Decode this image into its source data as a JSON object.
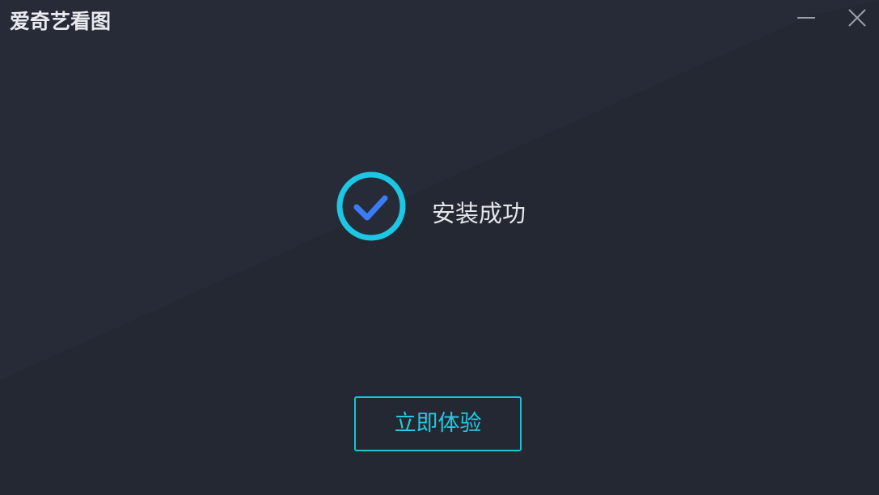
{
  "window": {
    "title": "爱奇艺看图"
  },
  "controls": {
    "minimize_icon": "minimize-icon",
    "close_icon": "close-icon"
  },
  "status": {
    "icon": "check-circle-icon",
    "message": "安装成功"
  },
  "actions": {
    "primary_label": "立即体验"
  },
  "colors": {
    "background": "#262b37",
    "accent_cyan": "#1fc2d6",
    "check_blue": "#3b7cf6",
    "text": "#e4e6ea"
  }
}
